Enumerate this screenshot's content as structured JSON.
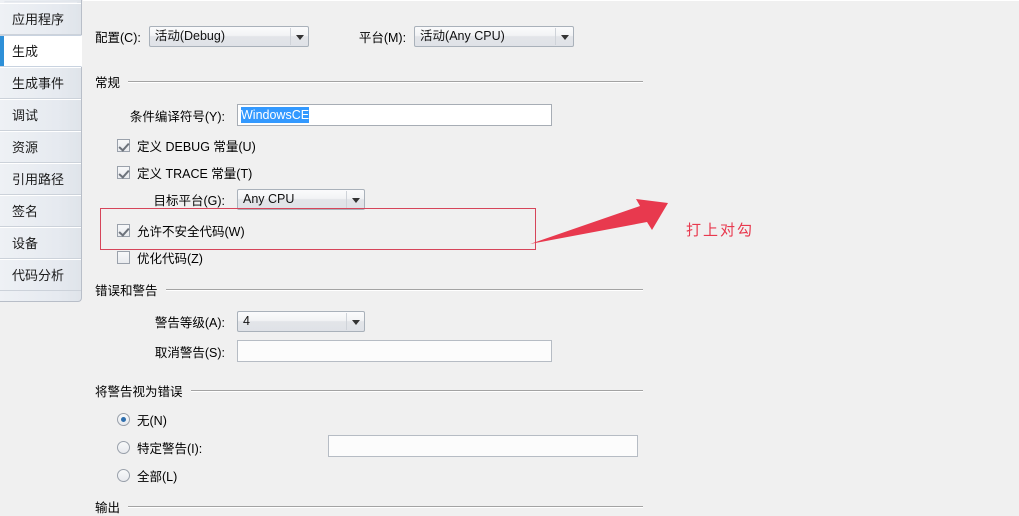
{
  "sidebar": {
    "items": [
      {
        "label": "应用程序",
        "selected": false
      },
      {
        "label": "生成",
        "selected": true
      },
      {
        "label": "生成事件",
        "selected": false
      },
      {
        "label": "调试",
        "selected": false
      },
      {
        "label": "资源",
        "selected": false
      },
      {
        "label": "引用路径",
        "selected": false
      },
      {
        "label": "签名",
        "selected": false
      },
      {
        "label": "设备",
        "selected": false
      },
      {
        "label": "代码分析",
        "selected": false
      }
    ]
  },
  "toolbar": {
    "configuration_label": "配置(C):",
    "configuration_value": "活动(Debug)",
    "platform_label": "平台(M):",
    "platform_value": "活动(Any CPU)"
  },
  "general": {
    "section_title": "常规",
    "conditional_symbols_label": "条件编译符号(Y):",
    "conditional_symbols_value": "WindowsCE",
    "define_debug_label": "定义 DEBUG 常量(U)",
    "define_debug_checked": true,
    "define_trace_label": "定义 TRACE 常量(T)",
    "define_trace_checked": true,
    "target_platform_label": "目标平台(G):",
    "target_platform_value": "Any CPU",
    "allow_unsafe_label": "允许不安全代码(W)",
    "allow_unsafe_checked": true,
    "optimize_label": "优化代码(Z)",
    "optimize_checked": false
  },
  "errors_warnings": {
    "section_title": "错误和警告",
    "warning_level_label": "警告等级(A):",
    "warning_level_value": "4",
    "suppress_warnings_label": "取消警告(S):",
    "suppress_warnings_value": ""
  },
  "treat_warnings": {
    "section_title": "将警告视为错误",
    "none_label": "无(N)",
    "none_selected": true,
    "specific_label": "特定警告(I):",
    "specific_selected": false,
    "specific_value": "",
    "all_label": "全部(L)",
    "all_selected": false
  },
  "output": {
    "section_title": "输出"
  },
  "annotation": {
    "text": "打上对勾",
    "color": "#e8394e",
    "box_color": "#d6455a"
  }
}
